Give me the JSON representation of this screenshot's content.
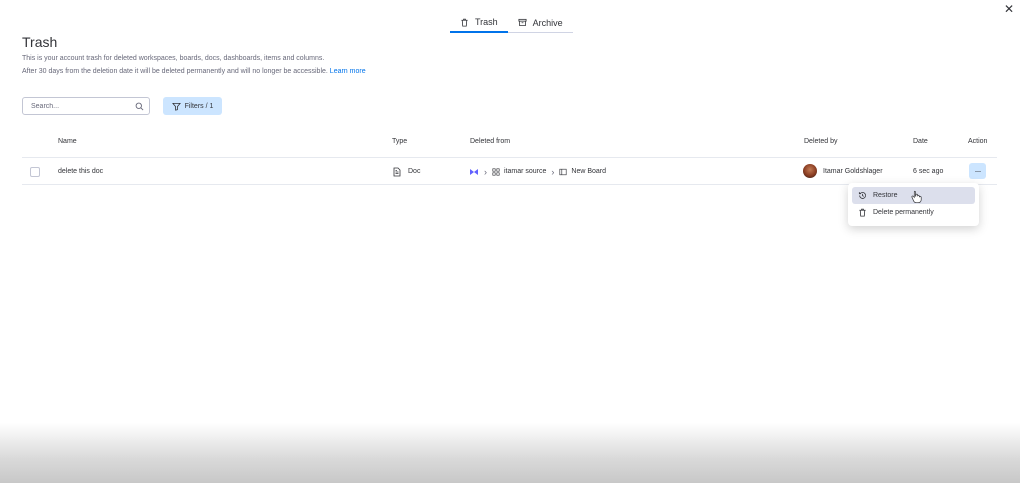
{
  "tabs": [
    {
      "label": "Trash",
      "icon": "trash-icon",
      "active": true
    },
    {
      "label": "Archive",
      "icon": "archive-icon",
      "active": false
    }
  ],
  "close": {
    "icon": "close-icon",
    "glyph": "✕"
  },
  "header": {
    "title": "Trash",
    "description_1": "This is your account trash for deleted workspaces, boards, docs, dashboards, items and columns.",
    "description_2": "After 30 days from the deletion date it will be deleted permanently and will no longer be accessible.",
    "learn_more": "Learn more"
  },
  "search": {
    "placeholder": "Search...",
    "value": ""
  },
  "filters": {
    "label": "Filters / 1"
  },
  "table": {
    "columns": {
      "name": "Name",
      "type": "Type",
      "deleted_from": "Deleted from",
      "deleted_by": "Deleted by",
      "date": "Date",
      "action": "Action"
    },
    "rows": [
      {
        "name": "delete this doc",
        "type": "Doc",
        "path_workspace": "itamar source",
        "path_board": "New Board",
        "deleted_by": "Itamar Goldshlager",
        "date": "6 sec ago",
        "action_glyph": "···"
      }
    ]
  },
  "menu": {
    "items": [
      {
        "label": "Restore",
        "icon": "restore-icon"
      },
      {
        "label": "Delete permanently",
        "icon": "trash-icon"
      }
    ]
  },
  "colors": {
    "accent": "#0073ea",
    "selected_bg": "#cce5ff",
    "hover_bg": "#dcdfec",
    "workspace_icon": "#6161ff"
  }
}
